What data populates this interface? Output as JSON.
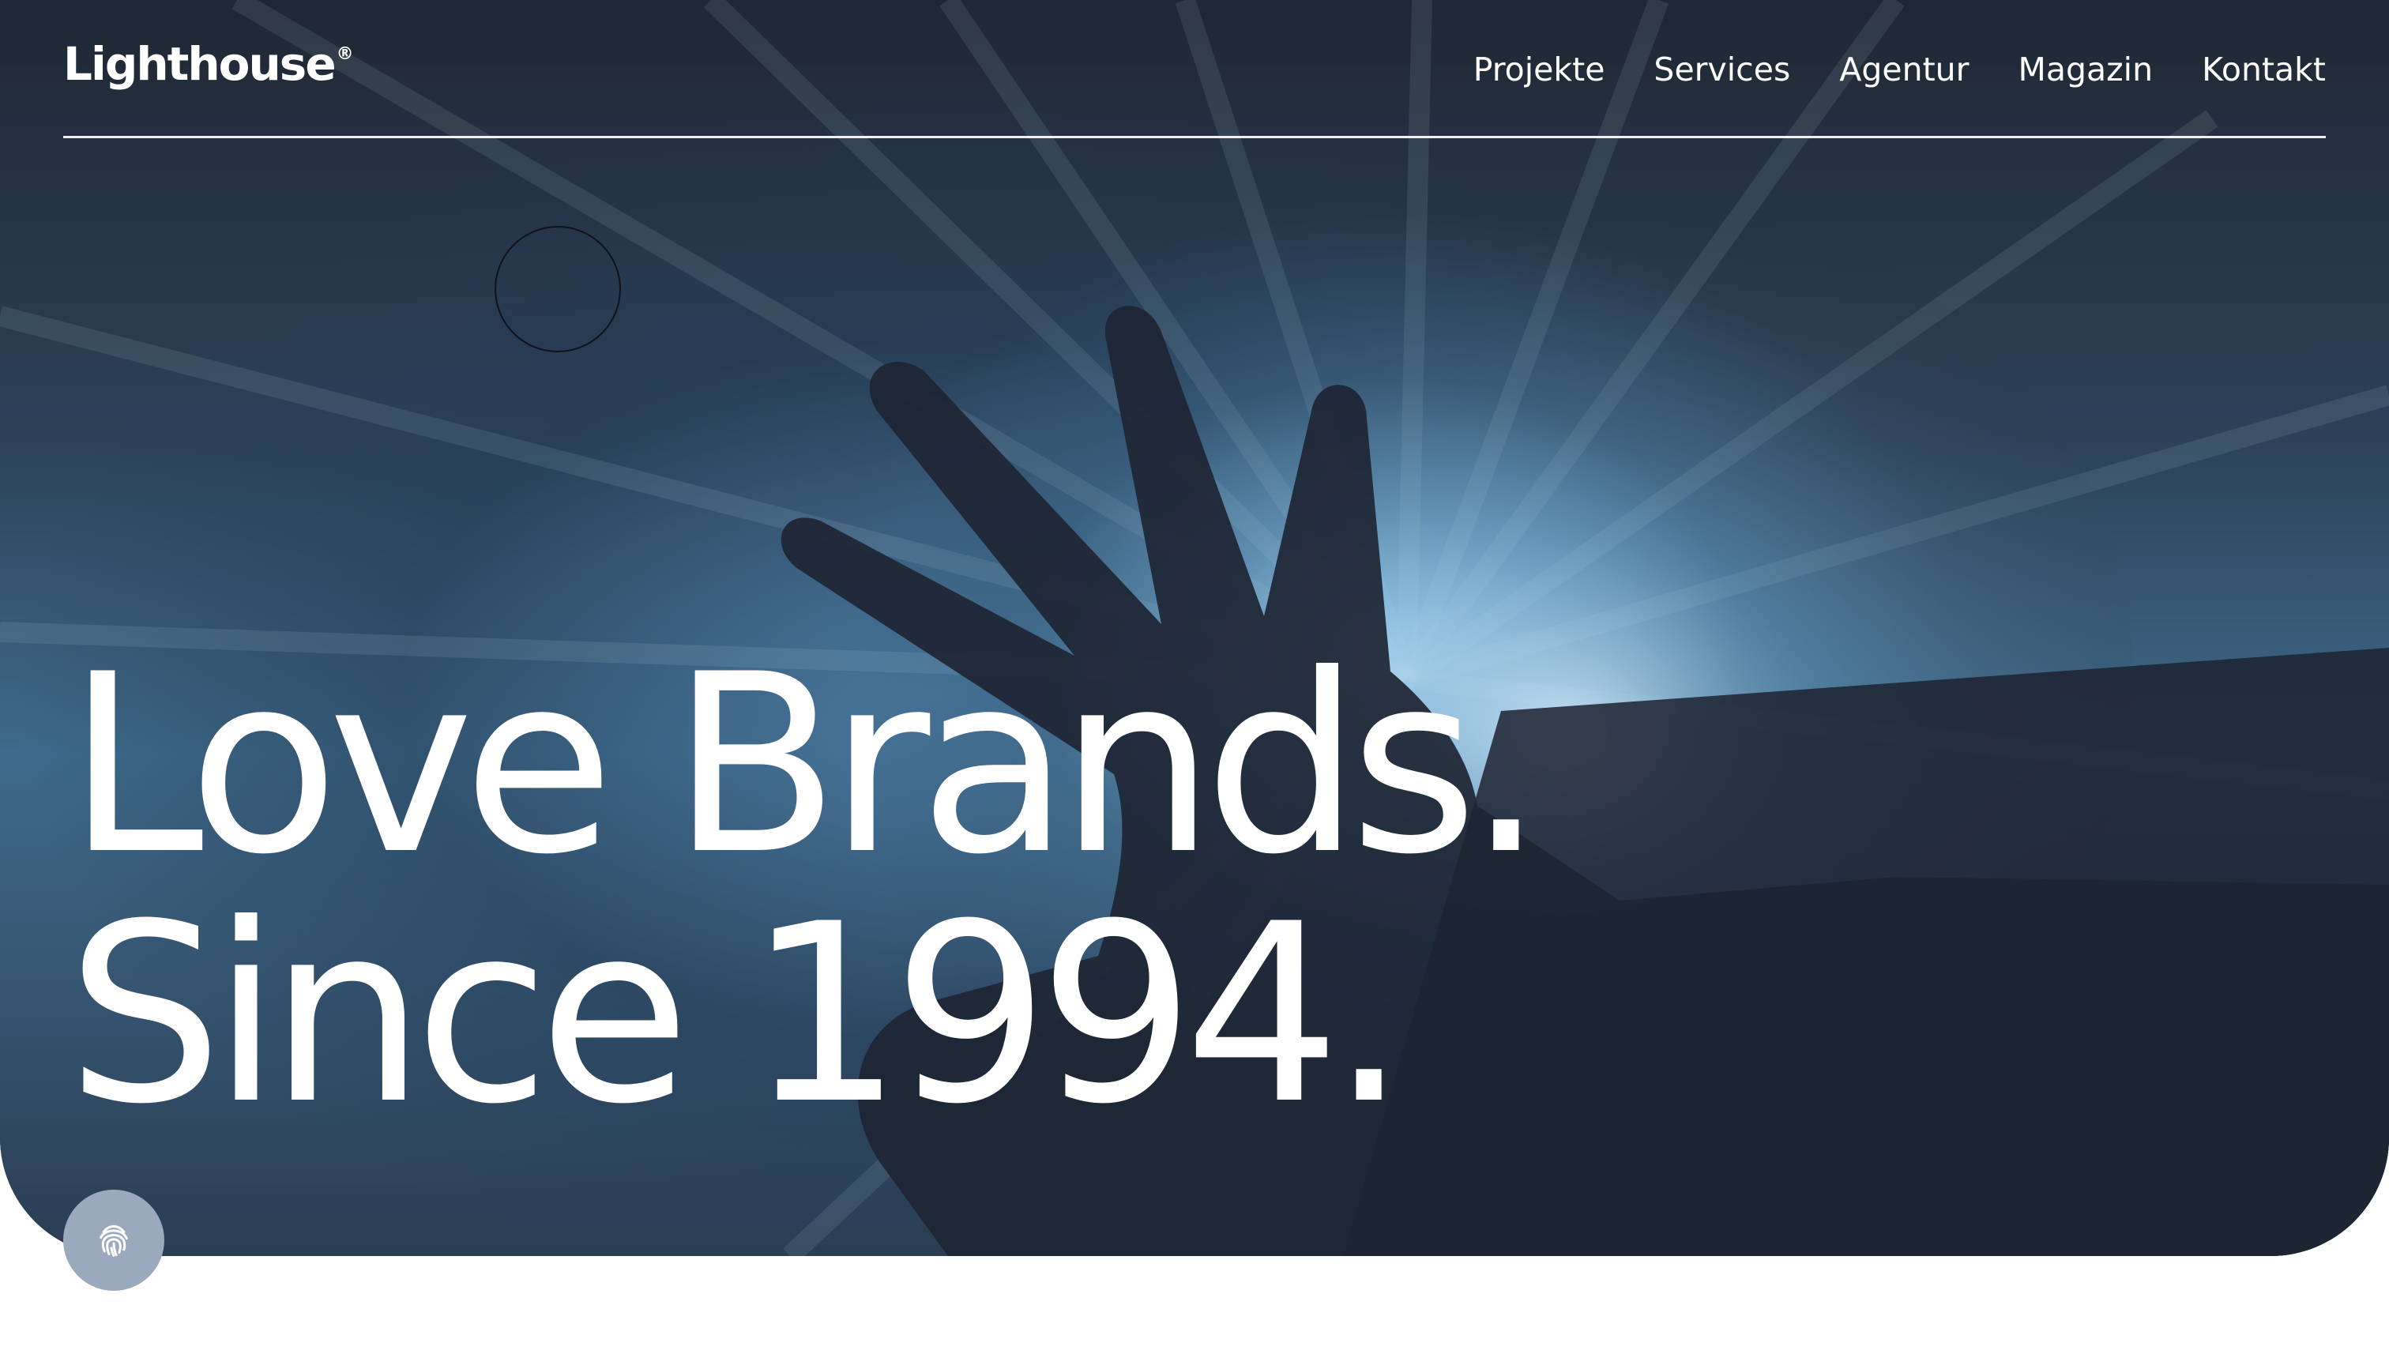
{
  "header": {
    "logo": "Lighthouse",
    "logo_mark": "®",
    "nav": [
      {
        "label": "Projekte"
      },
      {
        "label": "Services"
      },
      {
        "label": "Agentur"
      },
      {
        "label": "Magazin"
      },
      {
        "label": "Kontakt"
      }
    ]
  },
  "hero": {
    "headline_line1": "Love Brands.",
    "headline_line2": "Since 1994."
  },
  "floating_button": {
    "icon": "fingerprint-icon"
  },
  "colors": {
    "hero_dark": "#1b222d",
    "hero_light": "#aad7f5",
    "button_bg": "#9ba9bd",
    "text": "#ffffff"
  }
}
